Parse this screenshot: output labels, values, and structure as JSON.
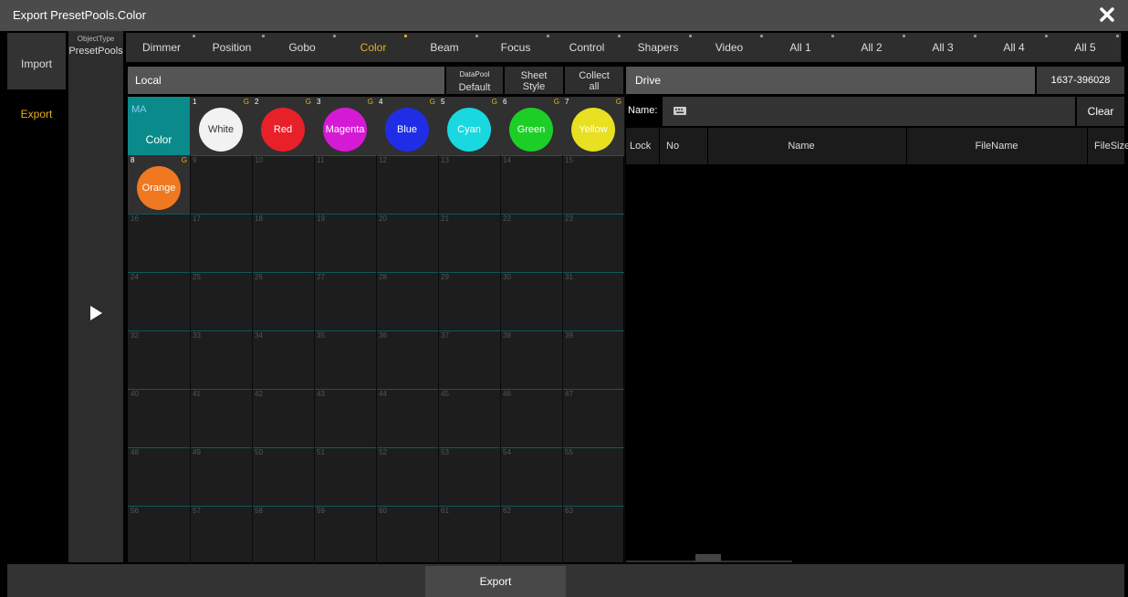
{
  "window": {
    "title": "Export PresetPools.Color"
  },
  "left_tabs": {
    "import": "Import",
    "export": "Export"
  },
  "object_type": {
    "label": "ObjectType",
    "value": "PresetPools"
  },
  "pool_tabs": [
    "Dimmer",
    "Position",
    "Gobo",
    "Color",
    "Beam",
    "Focus",
    "Control",
    "Shapers",
    "Video",
    "All 1",
    "All 2",
    "All 3",
    "All 4",
    "All 5"
  ],
  "active_pool_tab": "Color",
  "local": {
    "label": "Local"
  },
  "datapool": {
    "label": "DataPool",
    "value": "Default"
  },
  "sheet_style": {
    "line1": "Sheet",
    "line2": "Style"
  },
  "collect_all": {
    "line1": "Collect",
    "line2": "all"
  },
  "pool_header": {
    "ma": "MA",
    "title": "Color"
  },
  "presets": [
    {
      "no": "1",
      "name": "White",
      "color": "#f2f2f2",
      "flag": "G",
      "dark": true
    },
    {
      "no": "2",
      "name": "Red",
      "color": "#e8202a",
      "flag": "G"
    },
    {
      "no": "3",
      "name": "Magenta",
      "color": "#d41ad4",
      "flag": "G"
    },
    {
      "no": "4",
      "name": "Blue",
      "color": "#1f2ee6",
      "flag": "G"
    },
    {
      "no": "5",
      "name": "Cyan",
      "color": "#19d8e0",
      "flag": "G"
    },
    {
      "no": "6",
      "name": "Green",
      "color": "#1ccf26",
      "flag": "G"
    },
    {
      "no": "7",
      "name": "Yellow",
      "color": "#e8e020",
      "flag": "G"
    },
    {
      "no": "8",
      "name": "Orange",
      "color": "#f07820",
      "flag": "G"
    }
  ],
  "empty_cells": [
    "9",
    "10",
    "11",
    "12",
    "13",
    "14",
    "15",
    "16",
    "17",
    "18",
    "19",
    "20",
    "21",
    "22",
    "23",
    "24",
    "25",
    "26",
    "27",
    "28",
    "29",
    "30",
    "31",
    "32",
    "33",
    "34",
    "35",
    "36",
    "37",
    "38",
    "39",
    "40",
    "41",
    "42",
    "43",
    "44",
    "45",
    "46",
    "47",
    "48",
    "49",
    "50",
    "51",
    "52",
    "53",
    "54",
    "55",
    "56",
    "57",
    "58",
    "59",
    "60",
    "61",
    "62",
    "63"
  ],
  "drive": {
    "label": "Drive",
    "code": "1637-396028"
  },
  "filter": {
    "label": "Name:",
    "clear": "Clear"
  },
  "columns": [
    "Lock",
    "No",
    "Name",
    "FileName",
    "FileSize"
  ],
  "footer": {
    "export": "Export"
  }
}
